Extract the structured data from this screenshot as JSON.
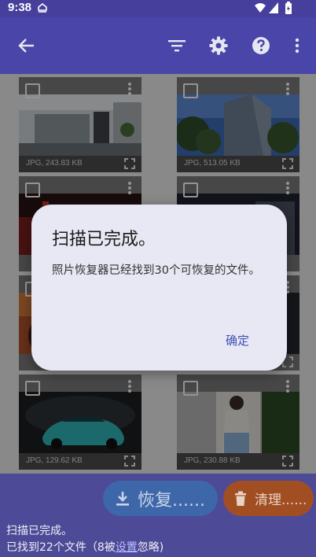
{
  "status_bar": {
    "time": "9:38"
  },
  "app_bar": {
    "back_icon": "arrow-left-icon",
    "filter_icon": "filter-icon",
    "settings_icon": "gear-icon",
    "help_icon": "help-circle-icon",
    "more_icon": "more-vertical-icon"
  },
  "photos": [
    {
      "meta": "JPG, 243.83 KB",
      "scene": "interior"
    },
    {
      "meta": "JPG, 513.05 KB",
      "scene": "building"
    },
    {
      "meta": "",
      "scene": "dark-red"
    },
    {
      "meta": "",
      "scene": "dark-city"
    },
    {
      "meta": "",
      "scene": "sunset"
    },
    {
      "meta": "",
      "scene": "gray"
    },
    {
      "meta": "JPG, 129.62 KB",
      "scene": "car"
    },
    {
      "meta": "JPG, 230.88 KB",
      "scene": "portrait"
    }
  ],
  "dialog": {
    "title": "扫描已完成。",
    "message": "照片恢复器已经找到30个可恢复的文件。",
    "ok_label": "确定"
  },
  "bottom": {
    "restore_label": "恢复......",
    "clean_label": "清理......",
    "status_line1": "扫描已完成。",
    "status_prefix": "已找到22个文件（8被",
    "status_link": "设置",
    "status_suffix": "忽略)"
  },
  "colors": {
    "app_bar": "#4a45a8",
    "restore_button": "#3d67a8",
    "clean_button": "#a14e23",
    "dialog_bg": "#e8e8f5",
    "accent": "#3f51b5"
  }
}
